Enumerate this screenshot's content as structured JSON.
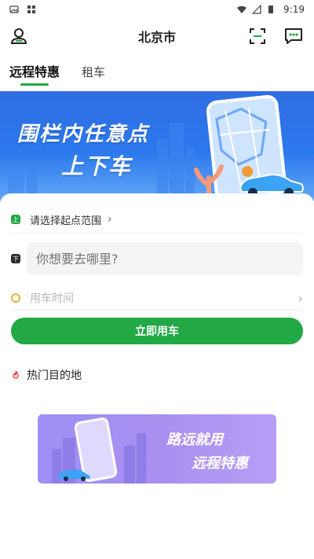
{
  "status_bar": {
    "time": "9:19"
  },
  "header": {
    "city": "北京市"
  },
  "tabs": [
    {
      "label": "远程特惠",
      "active": true
    },
    {
      "label": "租车",
      "active": false
    }
  ],
  "banner": {
    "line1": "围栏内任意点",
    "line2": "上下车"
  },
  "form": {
    "start_badge": "上",
    "start_label": "请选择起点范围",
    "dest_badge": "下",
    "dest_placeholder": "你想要去哪里?",
    "time_label": "用车时间"
  },
  "cta": {
    "label": "立即用车"
  },
  "hot": {
    "label": "热门目的地"
  },
  "promo": {
    "line1": "路远就用",
    "line2": "远程特惠"
  },
  "colors": {
    "accent": "#22a845",
    "banner": "#2f6ee3",
    "promo": "#a88ff0"
  }
}
